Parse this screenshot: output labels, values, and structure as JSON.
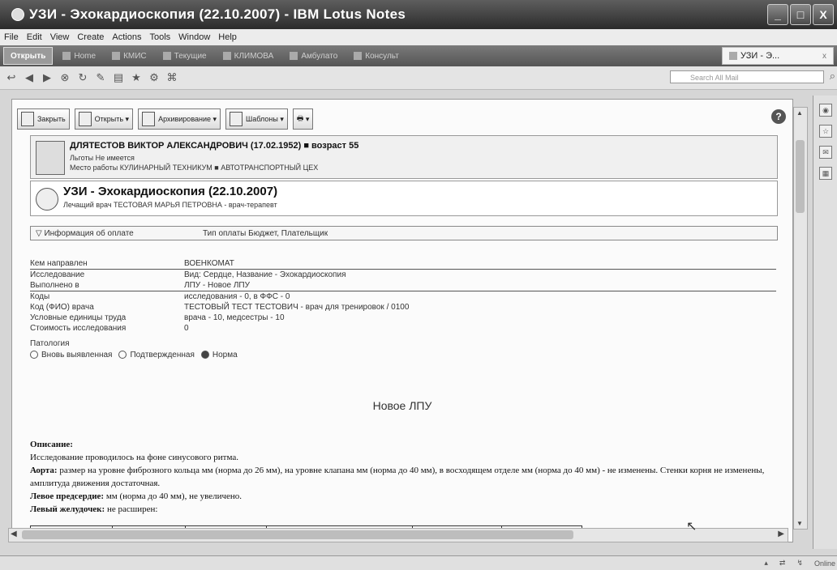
{
  "window": {
    "title": "УЗИ - Эхокардиоскопия (22.10.2007) - IBM Lotus Notes",
    "controls": [
      "_",
      "□",
      "X"
    ]
  },
  "menu": [
    "File",
    "Edit",
    "View",
    "Create",
    "Actions",
    "Tools",
    "Window",
    "Help"
  ],
  "tabs": {
    "open_label": "Открыть",
    "items": [
      "Home",
      "КМИС",
      "Текущие",
      "КЛИМОВА",
      "Амбулато",
      "Консульт"
    ],
    "active": "УЗИ - Э...",
    "close": "x"
  },
  "toolbar": {
    "search_placeholder": "Search All Mail"
  },
  "document": {
    "actions": [
      "Закрыть",
      "Открыть",
      "Архивирование",
      "Шаблоны"
    ],
    "help": "?",
    "patient": {
      "name": "ДЛЯТЕСТОВ ВИКТОР АЛЕКСАНДРОВИЧ (17.02.1952) ■ возраст 55",
      "benefits": "Льготы Не имеется",
      "work": "Место работы КУЛИНАРНЫЙ ТЕХНИКУМ ■ АВТОТРАНСПОРТНЫЙ ЦЕХ"
    },
    "study": {
      "title": "УЗИ - Эхокардиоскопия (22.10.2007)",
      "doctor": "Лечащий врач ТЕСТОВАЯ МАРЬЯ ПЕТРОВНА - врач-терапевт"
    },
    "payment": {
      "toggle": "▽ Информация об оплате",
      "type": "Тип оплаты Бюджет, Плательщик"
    },
    "fields": [
      {
        "label": "Кем направлен",
        "value": "ВОЕНКОМАТ"
      },
      {
        "label": "Исследование",
        "value": "Вид: Сердце, Название - Эхокардиоскопия"
      },
      {
        "label": "Выполнено в",
        "value": "ЛПУ - Новое ЛПУ"
      },
      {
        "label": "Коды",
        "value": "исследования - 0, в ФФС - 0"
      },
      {
        "label": "Код (ФИО) врача",
        "value": "ТЕСТОВЫЙ ТЕСТ ТЕСТОВИЧ - врач для тренировок / 0100"
      },
      {
        "label": "Условные единицы труда",
        "value": "врача - 10, медсестры - 10"
      },
      {
        "label": "Стоимость исследования",
        "value": "0"
      }
    ],
    "pathology": {
      "label": "Патология",
      "options": [
        "Вновь выявленная",
        "Подтвержденная",
        "Норма"
      ],
      "selected": "Норма"
    },
    "lpu_name": "Новое ЛПУ",
    "description": {
      "heading": "Описание:",
      "line1": "Исследование проводилось на фоне синусового ритма.",
      "aorta_label": "Аорта:",
      "aorta_text": "размер на уровне фиброзного кольца мм (норма до 26 мм), на уровне клапана мм (норма до 40 мм), в восходящем отделе мм (норма до 40 мм) - не изменены. Стенки корня не изменены, амплитуда движения достаточная.",
      "left_atrium_label": "Левое предсердие:",
      "left_atrium_text": "мм (норма до 40 мм), не увеличено.",
      "left_ventricle_label": "Левый желудочек:",
      "left_ventricle_text": "не расширен:"
    }
  },
  "statusbar": {
    "right": [
      "Online"
    ]
  }
}
